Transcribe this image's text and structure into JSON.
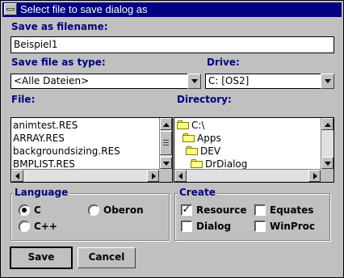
{
  "window": {
    "title": "Select file to save dialog as"
  },
  "filename": {
    "label": "Save as filename:",
    "value": "Beispiel1"
  },
  "filetype": {
    "label": "Save file as type:",
    "value": "<Alle Dateien>"
  },
  "drive": {
    "label": "Drive:",
    "value": "C:  [OS2]"
  },
  "files": {
    "label": "File:",
    "items": [
      "animtest.RES",
      "ARRAY.RES",
      "backgroundsizing.RES",
      "BMPLIST.RES"
    ]
  },
  "directory": {
    "label": "Directory:",
    "items": [
      "C:\\",
      "Apps",
      "DEV",
      "DrDialog"
    ]
  },
  "language": {
    "label": "Language",
    "options": [
      {
        "label": "C",
        "selected": true
      },
      {
        "label": "Oberon",
        "selected": false
      },
      {
        "label": "C++",
        "selected": false
      }
    ]
  },
  "create": {
    "label": "Create",
    "options": [
      {
        "label": "Resource",
        "checked": true,
        "mark": "✓"
      },
      {
        "label": "Equates",
        "checked": false,
        "mark": ""
      },
      {
        "label": "Dialog",
        "checked": false,
        "mark": ""
      },
      {
        "label": "WinProc",
        "checked": false,
        "mark": ""
      }
    ]
  },
  "buttons": {
    "save": "Save",
    "cancel": "Cancel"
  },
  "colors": {
    "titlebar": "#000080",
    "label": "#000080",
    "folder": "#ffff80"
  },
  "icons": {
    "folder": "folder-icon",
    "system_menu": "system-menu-icon"
  }
}
